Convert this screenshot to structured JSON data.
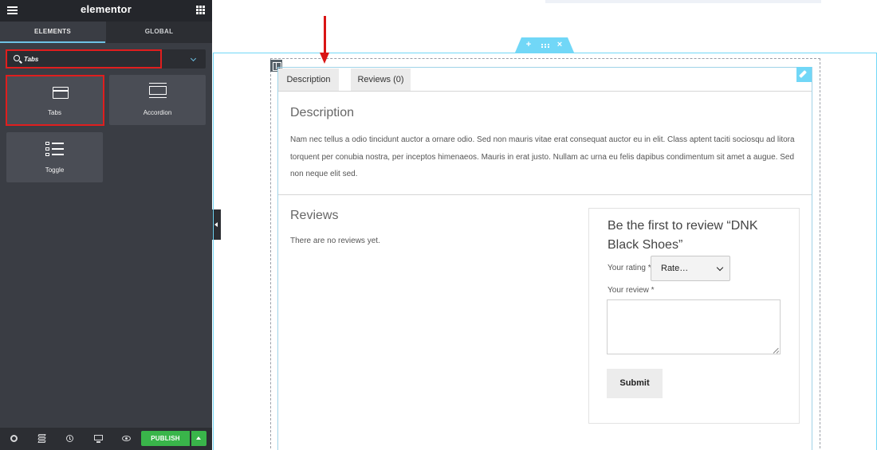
{
  "panel": {
    "brand": "elementor",
    "tabs": [
      "ELEMENTS",
      "GLOBAL"
    ],
    "search": {
      "value": "Tabs",
      "placeholder": ""
    },
    "widgets": [
      {
        "label": "Tabs",
        "icon": "tabs-icon"
      },
      {
        "label": "Accordion",
        "icon": "accordion-icon"
      },
      {
        "label": "Toggle",
        "icon": "toggle-icon"
      }
    ],
    "footer": {
      "icons": [
        "settings-icon",
        "navigator-layers-icon",
        "history-icon",
        "responsive-mode-icon",
        "preview-icon"
      ],
      "publish_label": "PUBLISH"
    }
  },
  "canvas": {
    "section_handle": {
      "add": "+",
      "move": "move-icon",
      "close": "×"
    },
    "tabs": [
      "Description",
      "Reviews (0)"
    ],
    "description": {
      "heading": "Description",
      "body": "Nam nec tellus a odio tincidunt auctor a ornare odio. Sed non mauris vitae erat consequat auctor eu in elit. Class aptent taciti sociosqu ad litora torquent per conubia nostra, per inceptos himenaeos. Mauris in erat justo. Nullam ac urna eu felis dapibus condimentum sit amet a augue. Sed non neque elit sed."
    },
    "reviews": {
      "heading": "Reviews",
      "empty_text": "There are no reviews yet.",
      "form": {
        "title": "Be the first to review “DNK Black Shoes”",
        "rating_label": "Your rating *",
        "rating_value": "Rate…",
        "review_label": "Your review *",
        "submit_label": "Submit"
      }
    }
  },
  "colors": {
    "panel_bg": "#3a3d44",
    "accent_blue": "#71d7f7",
    "publish_green": "#39b54a",
    "annotation_red": "#e01e1e"
  }
}
